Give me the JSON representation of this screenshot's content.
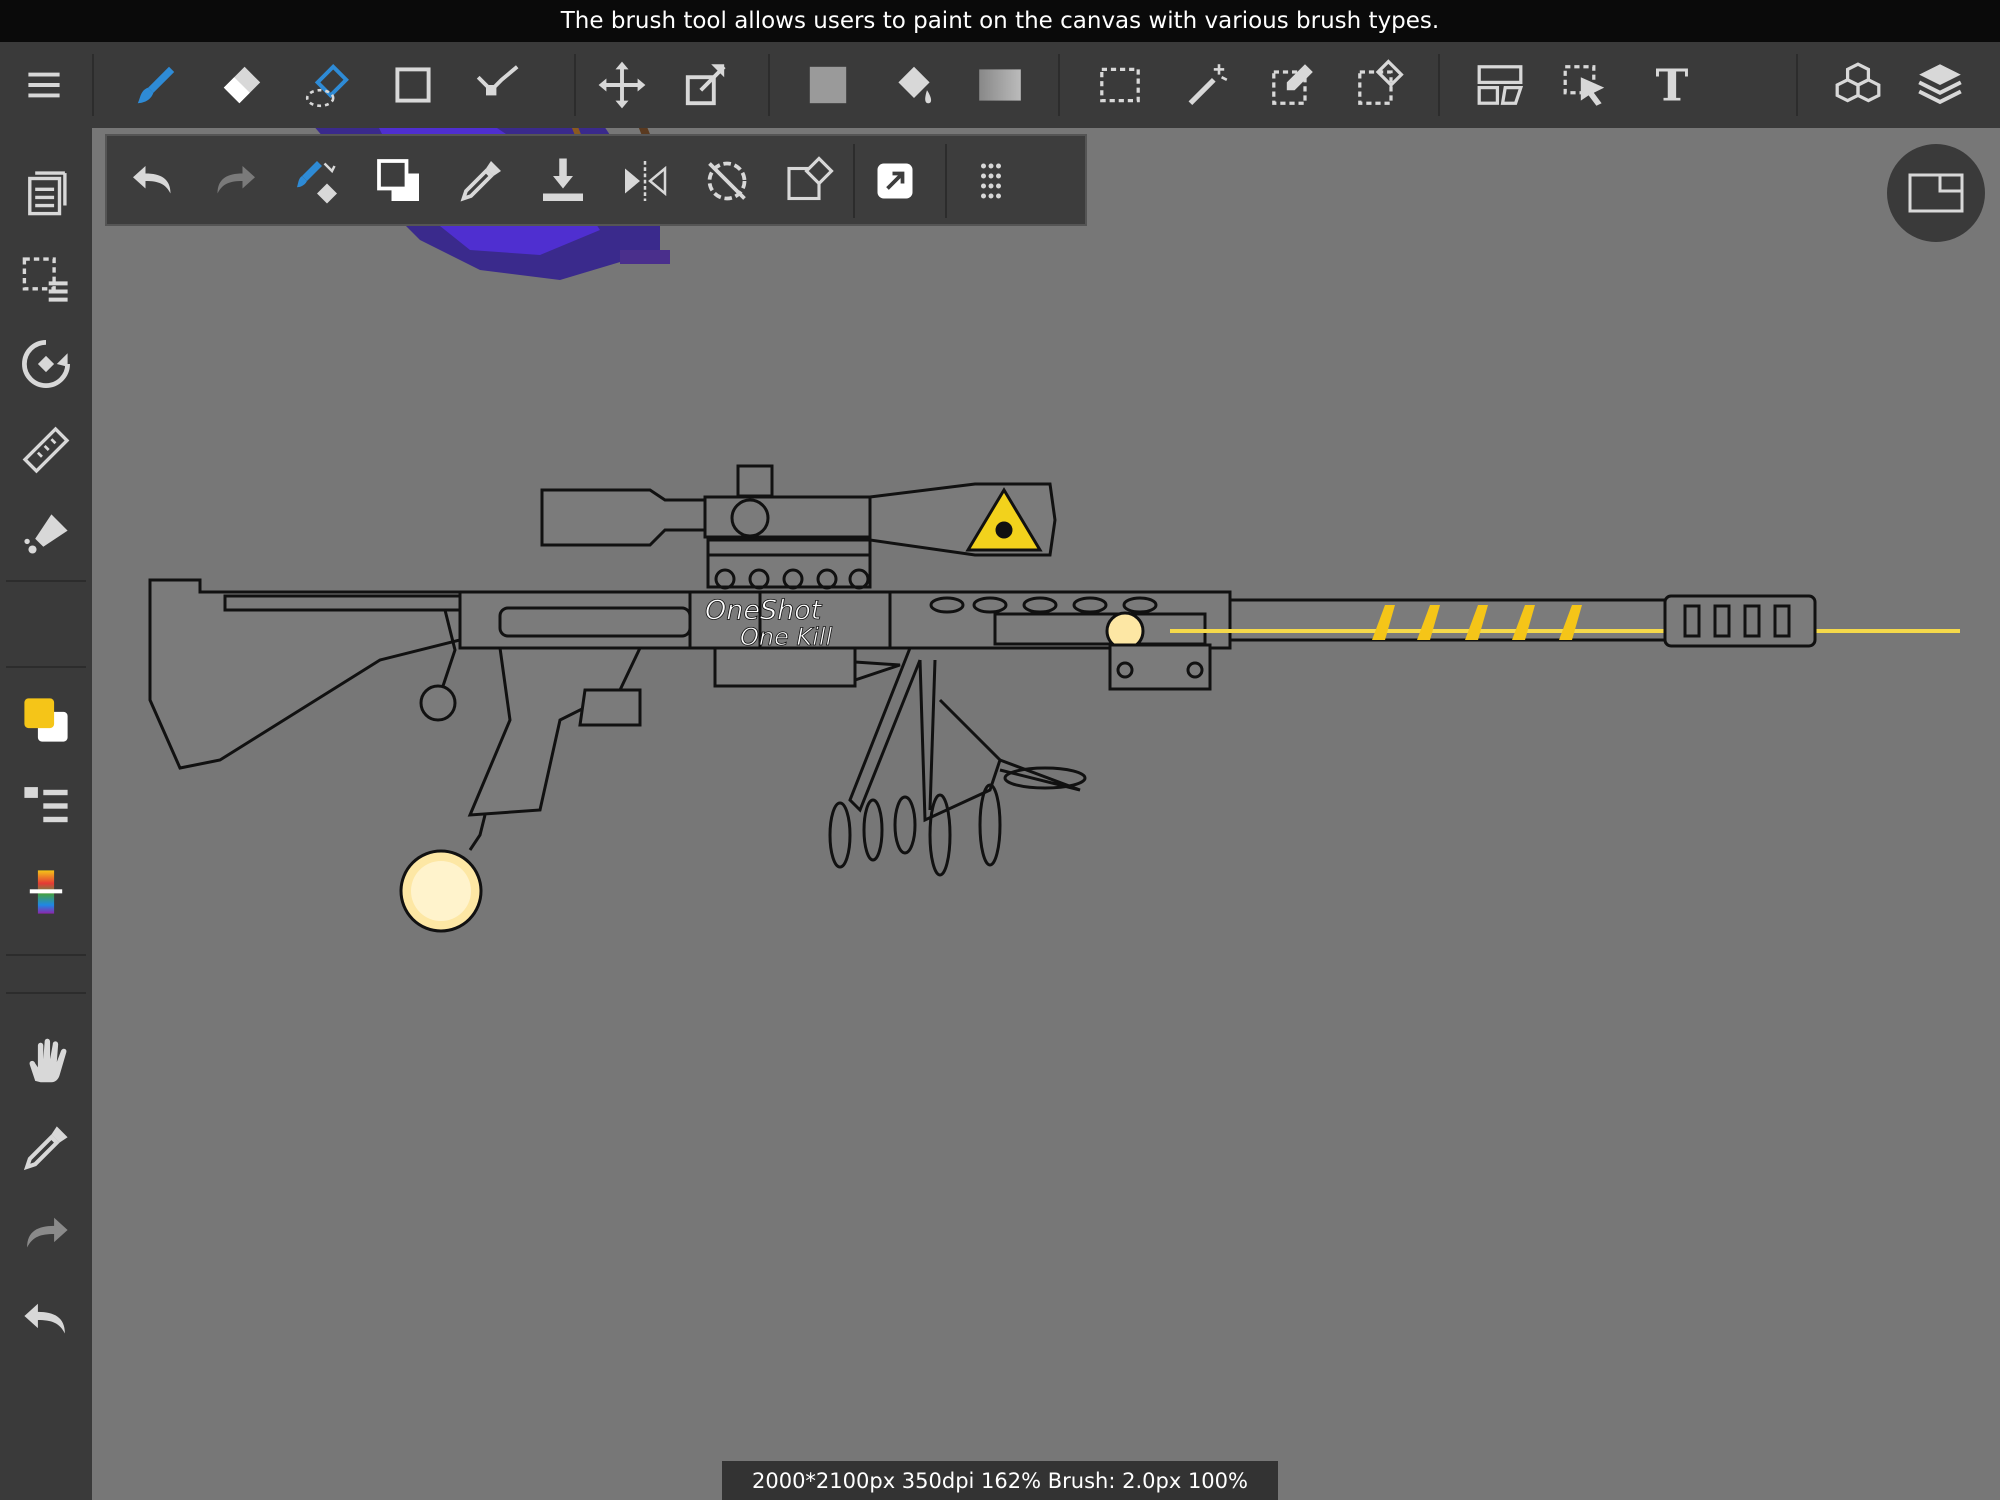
{
  "tooltip": "The brush tool allows users to paint on the canvas with various brush types.",
  "status_bar": "2000*2100px 350dpi 162% Brush: 2.0px 100%",
  "canvas_text": {
    "line1": "OneShot",
    "line2": "One Kill"
  },
  "colors": {
    "accent": "#2e8bd6",
    "foreground_color": "#f5c518",
    "background_color": "#ffffff",
    "ui_bg": "#3a3a3a",
    "canvas_bg": "#777777",
    "icon": "#d8d8d8"
  },
  "top_toolbar": {
    "tools": [
      "menu-icon",
      "brush-icon",
      "eraser-icon",
      "smudge-icon",
      "shape-icon",
      "line-icon",
      "move-icon",
      "transform-icon",
      "fill-color-icon",
      "bucket-icon",
      "gradient-icon",
      "select-rect-icon",
      "magic-wand-icon",
      "select-pen-icon",
      "select-eraser-icon",
      "frame-divider-icon",
      "select-arrow-icon",
      "text-icon",
      "3d-icon",
      "layers-icon"
    ],
    "active_tool": "brush-icon"
  },
  "left_sidebar": {
    "tools": [
      "gallery-icon",
      "selection-layer-icon",
      "snap-icon",
      "ruler-icon",
      "filter-icon",
      "color-swatch-icon",
      "brush-list-icon",
      "color-picker-icon",
      "hand-icon",
      "eyedropper-icon",
      "redo-icon",
      "undo-icon"
    ]
  },
  "sub_toolbar": {
    "tools": [
      "undo-icon",
      "redo-icon",
      "brush-eraser-toggle-icon",
      "color-swap-icon",
      "eyedropper-icon",
      "save-icon",
      "flip-icon",
      "rotate-reset-icon",
      "snap-erase-icon",
      "share-icon",
      "more-icon"
    ]
  }
}
